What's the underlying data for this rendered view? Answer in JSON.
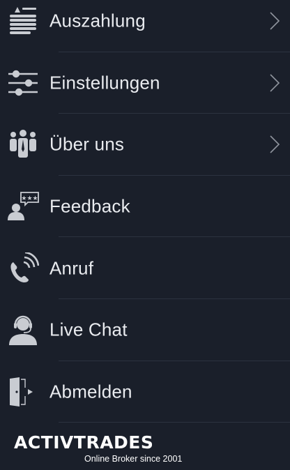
{
  "menu": {
    "items": [
      {
        "label": "Auszahlung",
        "icon": "withdraw-icon",
        "has_chevron": true
      },
      {
        "label": "Einstellungen",
        "icon": "settings-sliders-icon",
        "has_chevron": true
      },
      {
        "label": "Über uns",
        "icon": "team-icon",
        "has_chevron": true
      },
      {
        "label": "Feedback",
        "icon": "feedback-icon",
        "has_chevron": false
      },
      {
        "label": "Anruf",
        "icon": "phone-call-icon",
        "has_chevron": false
      },
      {
        "label": "Live Chat",
        "icon": "headset-agent-icon",
        "has_chevron": false
      },
      {
        "label": "Abmelden",
        "icon": "logout-door-icon",
        "has_chevron": false
      }
    ]
  },
  "brand": {
    "name": "ACTIVTRADES",
    "tagline": "Online Broker since 2001"
  },
  "colors": {
    "background": "#1a1f2a",
    "text": "#e9ebef",
    "icon": "#c9ccd2",
    "divider": "#2c3340"
  }
}
